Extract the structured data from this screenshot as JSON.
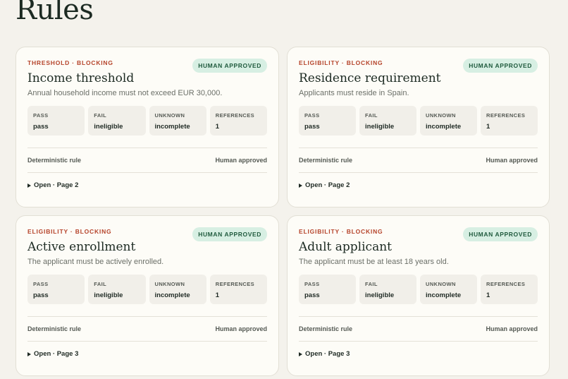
{
  "page": {
    "title": "Rules"
  },
  "cards": [
    {
      "kicker": "THRESHOLD · BLOCKING",
      "badge": "HUMAN APPROVED",
      "title": "Income threshold",
      "description": "Annual household income must not exceed EUR 30,000.",
      "stats": [
        {
          "label": "PASS",
          "value": "pass"
        },
        {
          "label": "FAIL",
          "value": "ineligible"
        },
        {
          "label": "UNKNOWN",
          "value": "incomplete"
        },
        {
          "label": "REFERENCES",
          "value": "1"
        }
      ],
      "meta_left": "Deterministic rule",
      "meta_right": "Human approved",
      "toggle": "Open · Page 2"
    },
    {
      "kicker": "ELIGIBILITY · BLOCKING",
      "badge": "HUMAN APPROVED",
      "title": "Residence requirement",
      "description": "Applicants must reside in Spain.",
      "stats": [
        {
          "label": "PASS",
          "value": "pass"
        },
        {
          "label": "FAIL",
          "value": "ineligible"
        },
        {
          "label": "UNKNOWN",
          "value": "incomplete"
        },
        {
          "label": "REFERENCES",
          "value": "1"
        }
      ],
      "meta_left": "Deterministic rule",
      "meta_right": "Human approved",
      "toggle": "Open · Page 2"
    },
    {
      "kicker": "ELIGIBILITY · BLOCKING",
      "badge": "HUMAN APPROVED",
      "title": "Active enrollment",
      "description": "The applicant must be actively enrolled.",
      "stats": [
        {
          "label": "PASS",
          "value": "pass"
        },
        {
          "label": "FAIL",
          "value": "ineligible"
        },
        {
          "label": "UNKNOWN",
          "value": "incomplete"
        },
        {
          "label": "REFERENCES",
          "value": "1"
        }
      ],
      "meta_left": "Deterministic rule",
      "meta_right": "Human approved",
      "toggle": "Open · Page 3"
    },
    {
      "kicker": "ELIGIBILITY · BLOCKING",
      "badge": "HUMAN APPROVED",
      "title": "Adult applicant",
      "description": "The applicant must be at least 18 years old.",
      "stats": [
        {
          "label": "PASS",
          "value": "pass"
        },
        {
          "label": "FAIL",
          "value": "ineligible"
        },
        {
          "label": "UNKNOWN",
          "value": "incomplete"
        },
        {
          "label": "REFERENCES",
          "value": "1"
        }
      ],
      "meta_left": "Deterministic rule",
      "meta_right": "Human approved",
      "toggle": "Open · Page 3"
    }
  ],
  "colors": {
    "background": "#f4f2ec",
    "card": "#fdfcf7",
    "kicker": "#b5432a",
    "badge_bg": "#d7efe3",
    "badge_text": "#1f5a3d"
  },
  "icons": {
    "toggle": "triangle-right-icon"
  }
}
